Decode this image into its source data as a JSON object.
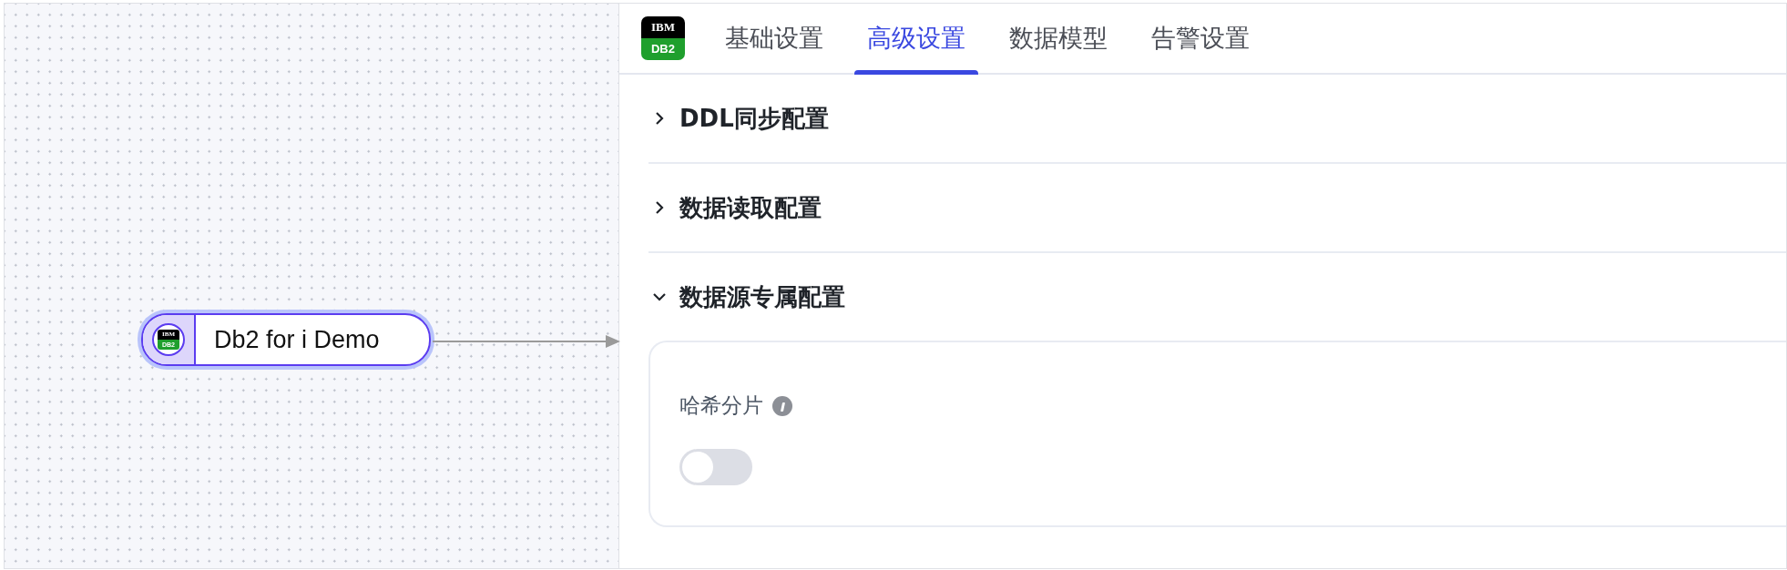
{
  "canvas": {
    "nodes": [
      {
        "label": "Db2 for i Demo",
        "selected": true,
        "icon": {
          "top": "IBM",
          "bottom": "DB2"
        }
      }
    ]
  },
  "panel": {
    "logo": {
      "top": "IBM",
      "bottom": "DB2"
    },
    "tabs": [
      {
        "label": "基础设置",
        "selected": false
      },
      {
        "label": "高级设置",
        "selected": true
      },
      {
        "label": "数据模型",
        "selected": false
      },
      {
        "label": "告警设置",
        "selected": false
      }
    ],
    "sections": [
      {
        "title": "DDL同步配置",
        "expanded": false
      },
      {
        "title": "数据读取配置",
        "expanded": false
      },
      {
        "title": "数据源专属配置",
        "expanded": true,
        "fields": [
          {
            "kind": "switch",
            "label": "哈希分片",
            "on": false
          }
        ]
      }
    ]
  }
}
